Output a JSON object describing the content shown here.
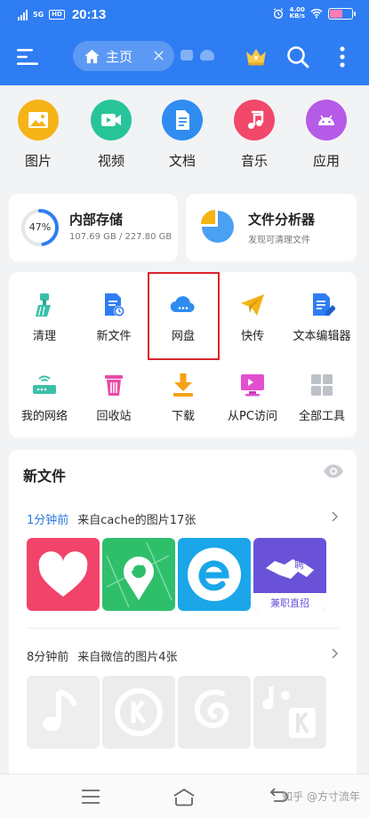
{
  "status_bar": {
    "network_label": "5G",
    "hd_label": "HD",
    "time": "20:13",
    "speed_value": "4.00",
    "speed_unit": "KB/s",
    "battery_color": "#ff7cb4"
  },
  "header": {
    "accent_color": "#2f7df3",
    "tab_label": "主页",
    "icons": [
      "menu-icon",
      "home-icon",
      "close-icon",
      "crown-icon",
      "search-icon",
      "more-icon"
    ]
  },
  "categories": [
    {
      "label": "图片",
      "icon": "image-icon",
      "color": "#f5b316"
    },
    {
      "label": "视频",
      "icon": "video-icon",
      "color": "#27c49a"
    },
    {
      "label": "文档",
      "icon": "document-icon",
      "color": "#2f8cf0"
    },
    {
      "label": "音乐",
      "icon": "music-icon",
      "color": "#f2486a"
    },
    {
      "label": "应用",
      "icon": "android-icon",
      "color": "#b65ae8"
    }
  ],
  "storage": {
    "percent": 47,
    "percent_label": "47%",
    "title": "内部存储",
    "detail": "107.69 GB / 227.80 GB"
  },
  "analyzer": {
    "title": "文件分析器",
    "subtitle": "发现可清理文件"
  },
  "tools": [
    {
      "label": "清理",
      "icon": "broom-icon"
    },
    {
      "label": "新文件",
      "icon": "new-file-icon"
    },
    {
      "label": "网盘",
      "icon": "cloud-icon",
      "highlighted": true
    },
    {
      "label": "快传",
      "icon": "paper-plane-icon"
    },
    {
      "label": "文本编辑器",
      "icon": "text-editor-icon"
    },
    {
      "label": "我的网络",
      "icon": "router-icon"
    },
    {
      "label": "回收站",
      "icon": "trash-icon"
    },
    {
      "label": "下载",
      "icon": "download-icon"
    },
    {
      "label": "从PC访问",
      "icon": "pc-access-icon"
    },
    {
      "label": "全部工具",
      "icon": "grid-icon"
    }
  ],
  "new_files": {
    "title": "新文件",
    "groups": [
      {
        "when": "1分钟前",
        "desc": "来自cache的图片17张",
        "thumbs": [
          "heart-app-icon",
          "map-pin-app-icon",
          "e-app-icon",
          "handshake-app-icon"
        ],
        "badge_char": "聘",
        "badge_text": "兼职直招"
      },
      {
        "when": "8分钟前",
        "desc": "来自微信的图片4张",
        "thumbs": [
          "music-note-icon",
          "k-music-icon",
          "netease-music-icon",
          "k-music-alt-icon"
        ]
      }
    ]
  },
  "nav": {
    "icons": [
      "menu-nav-icon",
      "home-nav-icon",
      "back-nav-icon"
    ],
    "watermark": "知乎 @方寸流年"
  }
}
